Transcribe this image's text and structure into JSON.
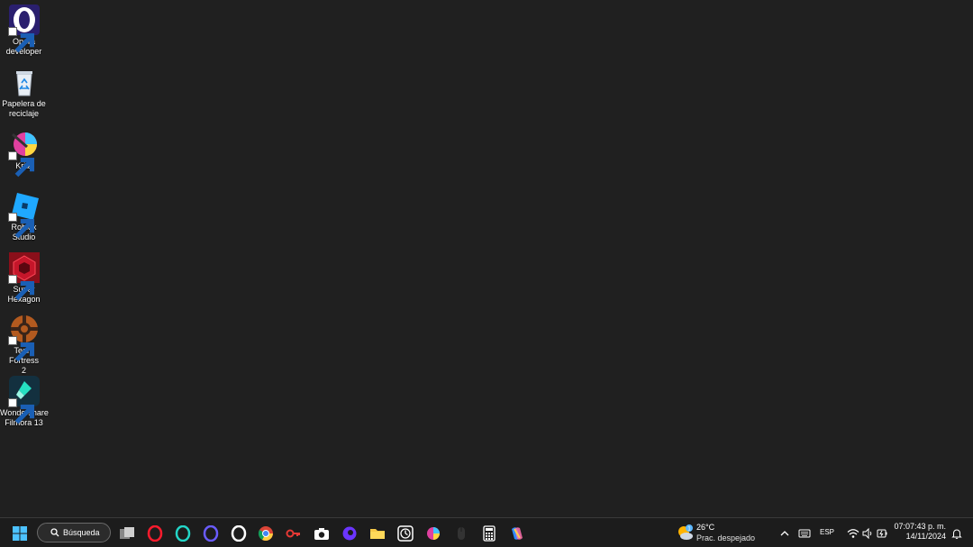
{
  "desktop": {
    "icons": [
      {
        "label_line1": "Opera",
        "label_line2": "developer",
        "icon": "opera-developer-icon",
        "shortcut": true
      },
      {
        "label_line1": "Papelera de",
        "label_line2": "reciclaje",
        "icon": "recycle-bin-icon",
        "shortcut": false
      },
      {
        "label_line1": "Krita",
        "label_line2": "",
        "icon": "krita-icon",
        "shortcut": true
      },
      {
        "label_line1": "Roblox",
        "label_line2": "Studio",
        "icon": "roblox-studio-icon",
        "shortcut": true
      },
      {
        "label_line1": "Super",
        "label_line2": "Hexagon",
        "icon": "super-hexagon-icon",
        "shortcut": true
      },
      {
        "label_line1": "Team Fortress",
        "label_line2": "2",
        "icon": "team-fortress-2-icon",
        "shortcut": true
      },
      {
        "label_line1": "Wondershare",
        "label_line2": "Filmora 13",
        "icon": "filmora-icon",
        "shortcut": true
      }
    ]
  },
  "taskbar": {
    "search_label": "Búsqueda",
    "pinned": [
      "start-icon",
      "task-view-icon",
      "opera-icon",
      "opera-gx-icon",
      "opera-air-icon",
      "opera-developer-icon",
      "chrome-icon",
      "key-app-icon",
      "camera-icon",
      "browser-app-icon",
      "file-explorer-icon",
      "clock-app-icon",
      "colorful-app-icon",
      "mouse-app-icon",
      "calculator-icon",
      "copilot-icon"
    ],
    "weather": {
      "temp": "26°C",
      "condition": "Prac. despejado",
      "badge": "1"
    },
    "language": "ESP",
    "time": "07:07:43 p. m.",
    "date": "14/11/2024"
  },
  "colors": {
    "desktop_bg": "#202020",
    "taskbar_bg": "#1c1c1c",
    "accent": "#0078d4"
  }
}
